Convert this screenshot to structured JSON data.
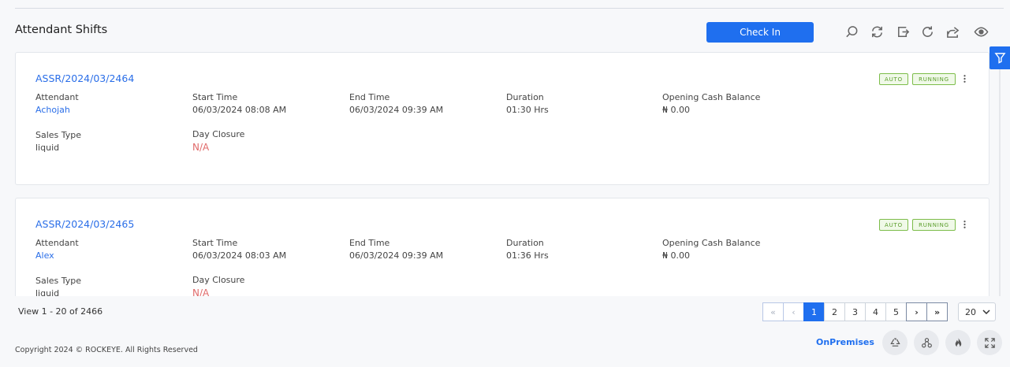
{
  "page": {
    "title": "Attendant Shifts",
    "check_in_label": "Check In"
  },
  "toolbar": {
    "icons": [
      "search-icon",
      "sync-icon",
      "export-icon",
      "refresh-icon",
      "share-icon",
      "eye-icon"
    ]
  },
  "cards": [
    {
      "id": "ASSR/2024/03/2464",
      "badges": [
        "AUTO",
        "RUNNING"
      ],
      "attendant_label": "Attendant",
      "attendant": "Achojah",
      "start_label": "Start Time",
      "start": "06/03/2024 08:08 AM",
      "end_label": "End Time",
      "end": "06/03/2024 09:39 AM",
      "duration_label": "Duration",
      "duration": "01:30 Hrs",
      "cash_label": "Opening Cash Balance",
      "cash": "₦ 0.00",
      "sales_type_label": "Sales Type",
      "sales_type": "liquid",
      "day_closure_label": "Day Closure",
      "day_closure": "N/A"
    },
    {
      "id": "ASSR/2024/03/2465",
      "badges": [
        "AUTO",
        "RUNNING"
      ],
      "attendant_label": "Attendant",
      "attendant": "Alex",
      "start_label": "Start Time",
      "start": "06/03/2024 08:03 AM",
      "end_label": "End Time",
      "end": "06/03/2024 09:39 AM",
      "duration_label": "Duration",
      "duration": "01:36 Hrs",
      "cash_label": "Opening Cash Balance",
      "cash": "₦ 0.00",
      "sales_type_label": "Sales Type",
      "sales_type": "liquid",
      "day_closure_label": "Day Closure",
      "day_closure": "N/A"
    }
  ],
  "pagination": {
    "summary": "View 1 - 20 of 2466",
    "first": "«",
    "prev": "‹",
    "pages": [
      "1",
      "2",
      "3",
      "4",
      "5"
    ],
    "current": "1",
    "next": "›",
    "last": "»",
    "page_size": "20"
  },
  "footer": {
    "copyright": "Copyright 2024 © ROCKEYE. All Rights Reserved",
    "mode": "OnPremises",
    "icons": [
      "recycle-icon",
      "network-icon",
      "fire-icon",
      "fullscreen-icon"
    ]
  },
  "colors": {
    "accent": "#1f6fef",
    "link": "#2a6ee8",
    "na": "#e06a6a",
    "badge_border": "#7dbd4a"
  }
}
